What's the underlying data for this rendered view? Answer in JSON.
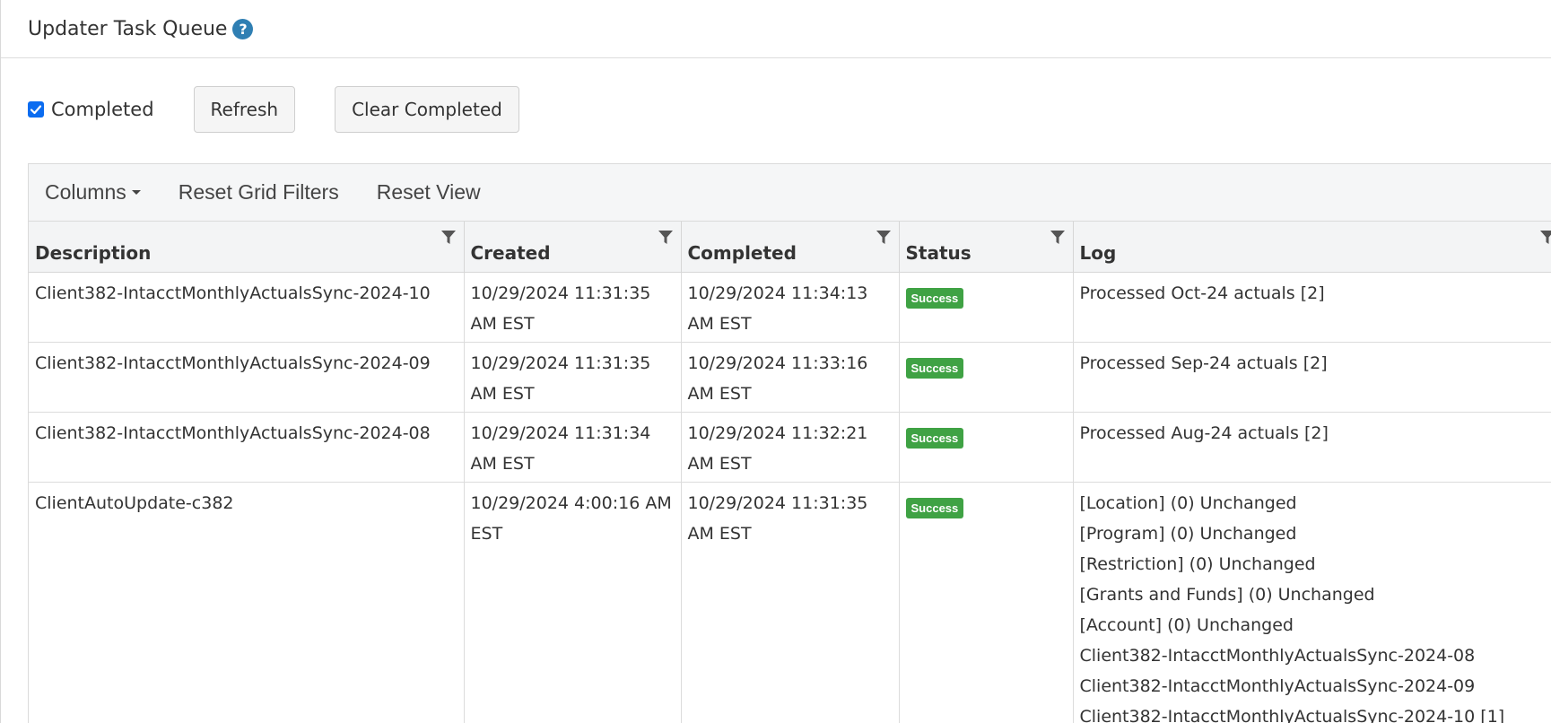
{
  "header": {
    "title": "Updater Task Queue",
    "help_icon": "?"
  },
  "toolbar": {
    "completed_checkbox": {
      "label": "Completed",
      "checked": true
    },
    "refresh_label": "Refresh",
    "clear_completed_label": "Clear Completed"
  },
  "grid_toolbar": {
    "columns_label": "Columns",
    "reset_filters_label": "Reset Grid Filters",
    "reset_view_label": "Reset View"
  },
  "columns": [
    "Description",
    "Created",
    "Completed",
    "Status",
    "Log"
  ],
  "rows": [
    {
      "description": "Client382-IntacctMonthlyActualsSync-2024-10",
      "created": "10/29/2024 11:31:35 AM EST",
      "completed": "10/29/2024 11:34:13 AM EST",
      "status": "Success",
      "log": [
        "Processed Oct-24 actuals [2]"
      ]
    },
    {
      "description": "Client382-IntacctMonthlyActualsSync-2024-09",
      "created": "10/29/2024 11:31:35 AM EST",
      "completed": "10/29/2024 11:33:16 AM EST",
      "status": "Success",
      "log": [
        "Processed Sep-24 actuals [2]"
      ]
    },
    {
      "description": "Client382-IntacctMonthlyActualsSync-2024-08",
      "created": "10/29/2024 11:31:34 AM EST",
      "completed": "10/29/2024 11:32:21 AM EST",
      "status": "Success",
      "log": [
        "Processed Aug-24 actuals [2]"
      ]
    },
    {
      "description": "ClientAutoUpdate-c382",
      "created": "10/29/2024 4:00:16 AM EST",
      "completed": "10/29/2024 11:31:35 AM EST",
      "status": "Success",
      "log": [
        "[Location] (0) Unchanged",
        "[Program] (0) Unchanged",
        "[Restriction] (0) Unchanged",
        "[Grants and Funds] (0) Unchanged",
        "[Account] (0) Unchanged",
        "Client382-IntacctMonthlyActualsSync-2024-08",
        "Client382-IntacctMonthlyActualsSync-2024-09",
        "Client382-IntacctMonthlyActualsSync-2024-10 [1]"
      ]
    }
  ],
  "colors": {
    "success_badge": "#3fa244",
    "help_icon": "#2f7fb3",
    "checkbox": "#0b6cf0"
  }
}
